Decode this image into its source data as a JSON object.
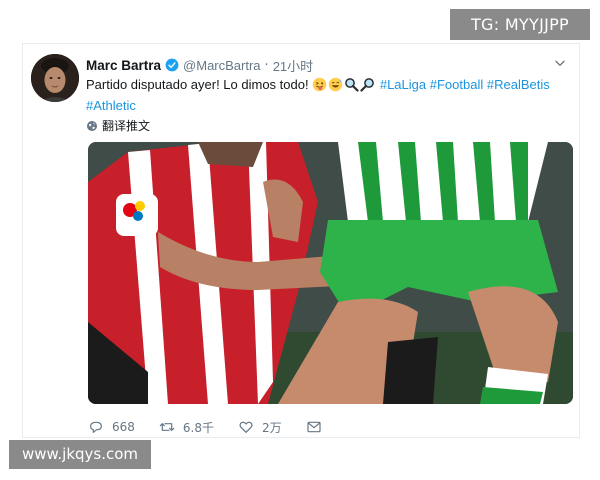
{
  "watermarks": {
    "top": "TG: MYYJJPP",
    "bottom": "www.jkqys.com"
  },
  "tweet": {
    "author_name": "Marc Bartra",
    "handle": "@MarcBartra",
    "separator": "·",
    "time": "21小时",
    "text": "Partido disputado ayer! Lo dimos todo!",
    "emojis": [
      "tongue-face-emoji",
      "grin-sweat-emoji",
      "magnifier-emoji",
      "magnifier-emoji"
    ],
    "hashtags": [
      "#LaLiga",
      "#Football",
      "#RealBetis",
      "#Athletic"
    ],
    "translate_label": "翻译推文",
    "image_alt": "Athletic Club player and Real Betis player in a match",
    "actions": {
      "replies": "668",
      "retweets": "6.8千",
      "likes": "2万",
      "dm": ""
    }
  },
  "colors": {
    "link": "#1b95e0",
    "muted": "#657786",
    "verified": "#1da1f2",
    "watermark_bg": "#8a8a8a"
  }
}
